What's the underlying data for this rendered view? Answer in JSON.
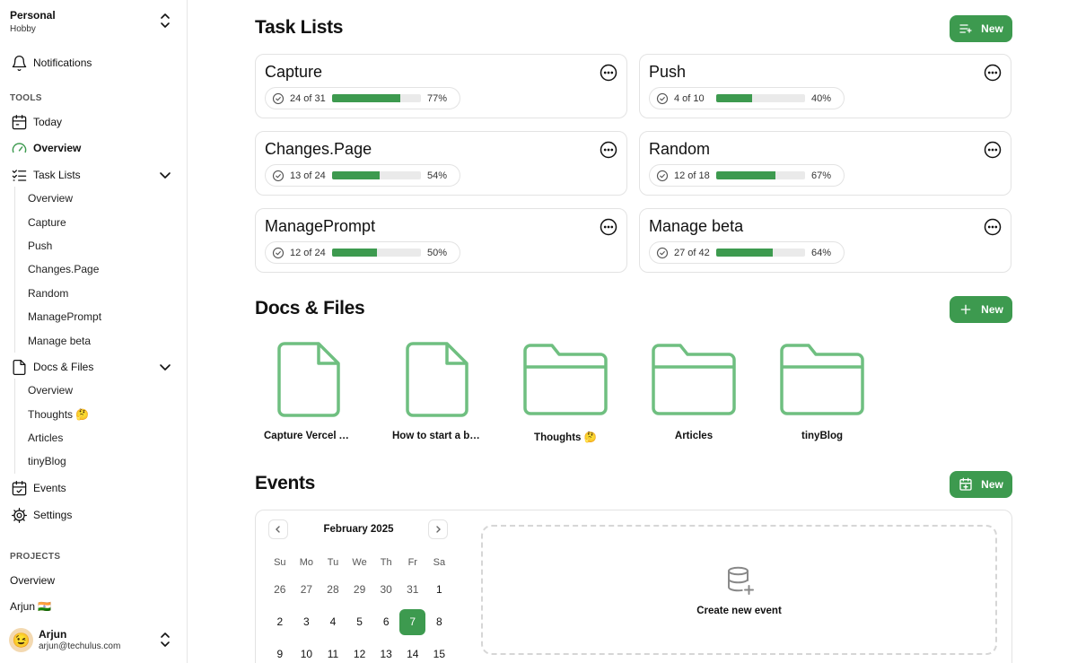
{
  "sidebar": {
    "team": {
      "name": "Personal",
      "plan": "Hobby"
    },
    "notifications": "Notifications",
    "tools_label": "TOOLS",
    "today": "Today",
    "overview": "Overview",
    "task_lists": {
      "label": "Task Lists",
      "children": [
        "Overview",
        "Capture",
        "Push",
        "Changes.Page",
        "Random",
        "ManagePrompt",
        "Manage beta"
      ]
    },
    "docs_files": {
      "label": "Docs & Files",
      "children": [
        "Overview",
        "Thoughts 🤔",
        "Articles",
        "tinyBlog"
      ]
    },
    "events": "Events",
    "settings": "Settings",
    "projects_label": "PROJECTS",
    "projects": [
      "Overview",
      "Arjun 🇮🇳"
    ],
    "user": {
      "name": "Arjun",
      "email": "arjun@techulus.com",
      "avatar": "😉"
    }
  },
  "task_lists": {
    "heading": "Task Lists",
    "new_label": "New",
    "cards": [
      {
        "title": "Capture",
        "count": "24 of 31",
        "progress": 0.77,
        "percent": "77%"
      },
      {
        "title": "Push",
        "count": "4 of 10",
        "progress": 0.4,
        "percent": "40%"
      },
      {
        "title": "Changes.Page",
        "count": "13 of 24",
        "progress": 0.54,
        "percent": "54%"
      },
      {
        "title": "Random",
        "count": "12 of 18",
        "progress": 0.67,
        "percent": "67%"
      },
      {
        "title": "ManagePrompt",
        "count": "12 of 24",
        "progress": 0.5,
        "percent": "50%"
      },
      {
        "title": "Manage beta",
        "count": "27 of 42",
        "progress": 0.64,
        "percent": "64%"
      }
    ]
  },
  "docs": {
    "heading": "Docs & Files",
    "new_label": "New",
    "items": [
      {
        "type": "file",
        "label": "Capture Vercel A…"
      },
      {
        "type": "file",
        "label": "How to start a bl…"
      },
      {
        "type": "folder",
        "label": "Thoughts 🤔"
      },
      {
        "type": "folder",
        "label": "Articles"
      },
      {
        "type": "folder",
        "label": "tinyBlog"
      }
    ]
  },
  "events": {
    "heading": "Events",
    "new_label": "New",
    "calendar": {
      "month": "February 2025",
      "weekdays": [
        "Su",
        "Mo",
        "Tu",
        "We",
        "Th",
        "Fr",
        "Sa"
      ],
      "days": [
        "26",
        "27",
        "28",
        "29",
        "30",
        "31",
        "1",
        "2",
        "3",
        "4",
        "5",
        "6",
        "7",
        "8",
        "9",
        "10",
        "11",
        "12",
        "13",
        "14",
        "15"
      ],
      "selected": "7"
    },
    "create_label": "Create new event"
  },
  "colors": {
    "accent": "#3d9a4f",
    "icon_green": "#6fbf80"
  }
}
